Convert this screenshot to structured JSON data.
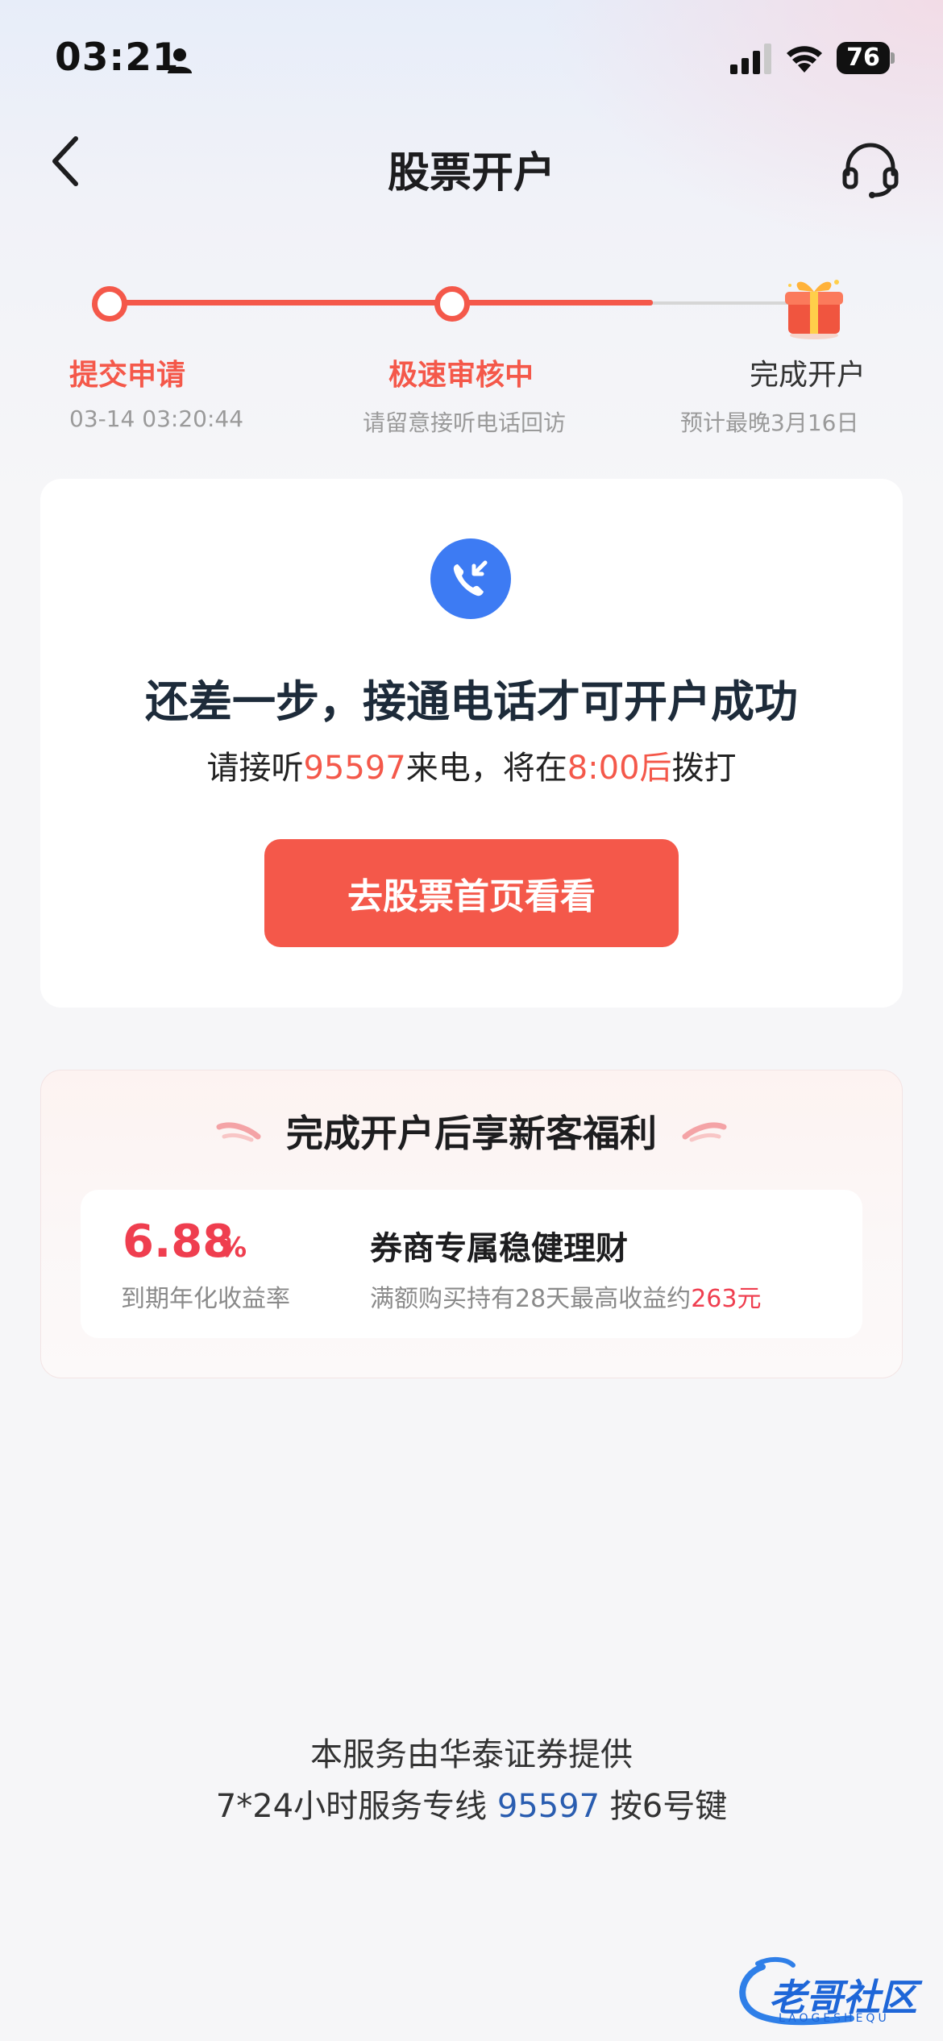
{
  "status_bar": {
    "time": "03:21",
    "battery": "76"
  },
  "nav": {
    "title": "股票开户"
  },
  "progress": {
    "steps": [
      {
        "label": "提交申请",
        "sub": "03-14 03:20:44"
      },
      {
        "label": "极速审核中",
        "sub": "请留意接听电话回访"
      },
      {
        "label": "完成开户",
        "sub": "预计最晚3月16日"
      }
    ]
  },
  "call_card": {
    "title": "还差一步，接通电话才可开户成功",
    "sub_pre": "请接听",
    "sub_phone": "95597",
    "sub_mid": "来电，将在",
    "sub_time": "8:00后",
    "sub_post": "拨打",
    "button": "去股票首页看看"
  },
  "benefit": {
    "title": "完成开户后享新客福利",
    "rate_value": "6.88",
    "rate_unit": "%",
    "rate_label": "到期年化收益率",
    "product_name": "券商专属稳健理财",
    "desc_pre": "满额购买持有28天最高收益约",
    "desc_amount": "263元"
  },
  "footer": {
    "line1": "本服务由华泰证券提供",
    "line2_pre": "7*24小时服务专线 ",
    "line2_phone": "95597",
    "line2_post": " 按6号键"
  },
  "watermark": {
    "text": "老哥社区",
    "sub": "LAOGESHEQU"
  },
  "colors": {
    "accent": "#f4584a",
    "blue": "#3d7bf3",
    "rate": "#ef3e4f"
  }
}
